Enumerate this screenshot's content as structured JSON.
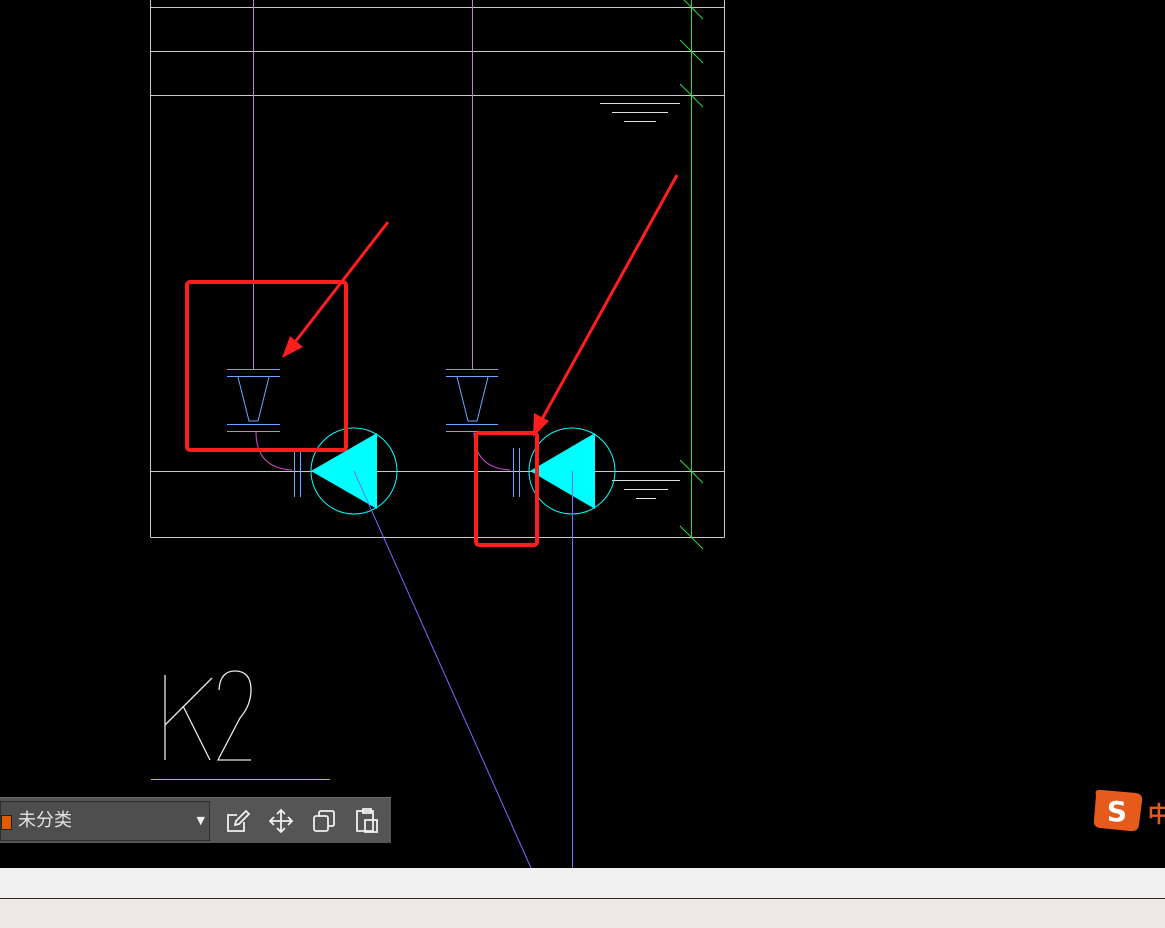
{
  "drawing": {
    "label": "K2",
    "colors": {
      "background": "#000000",
      "frame": "#c8c8c8",
      "pipe_violet": "#b482dc",
      "pipe_magenta": "#d24bd2",
      "rail_green": "#32dc32",
      "pump_cyan": "#00ffff",
      "valve_blue": "#6aa8ff",
      "leader_blue": "#7070ff",
      "annotation_red": "#ff1e1e",
      "underline_yellow": "#c8c800"
    }
  },
  "toolbar": {
    "category_label": "未分类",
    "category_color": "#e05a00",
    "buttons": [
      "edit-icon",
      "move-icon",
      "copy-icon",
      "paste-icon"
    ]
  },
  "ime": {
    "logo_letter": "S",
    "text": "中",
    "brand_color": "#e65a1c"
  }
}
